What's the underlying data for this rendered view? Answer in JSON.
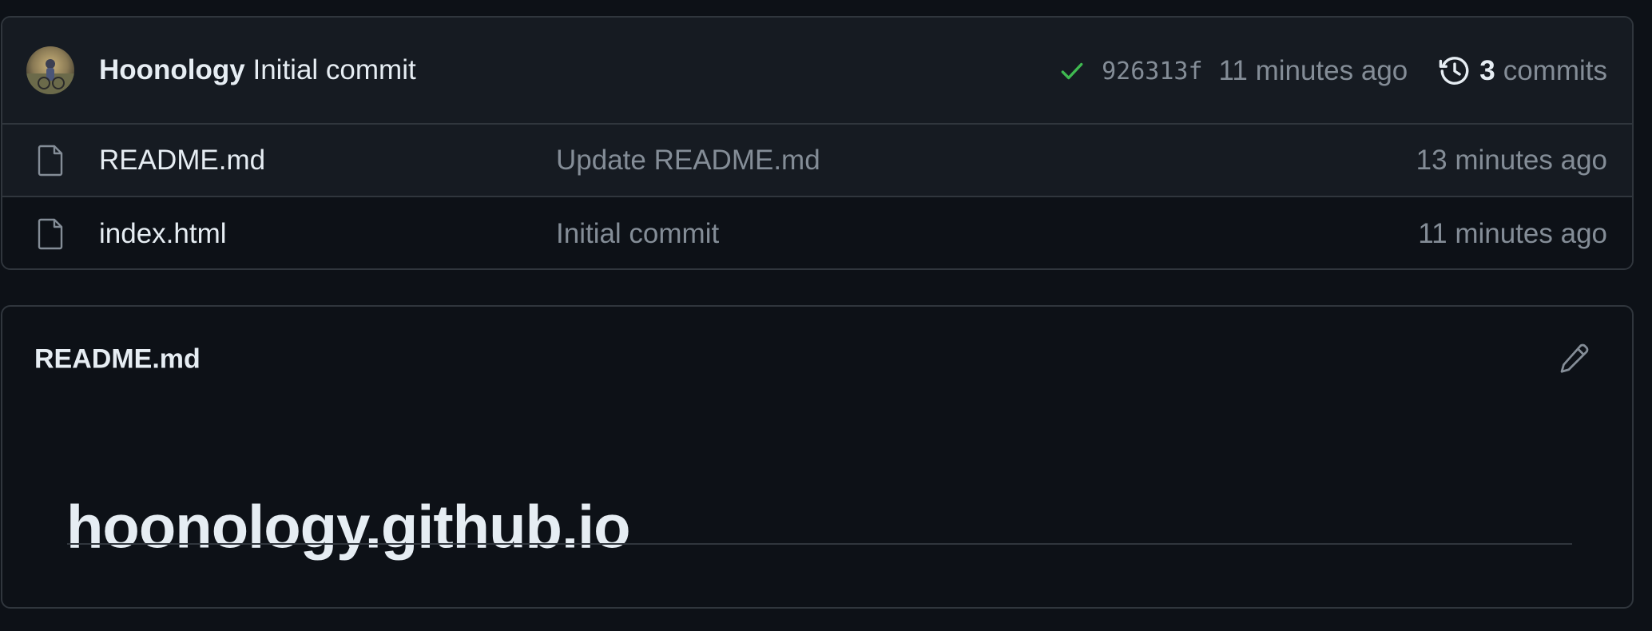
{
  "latest_commit": {
    "author": "Hoonology",
    "message": "Initial commit",
    "sha": "926313f",
    "time": "11 minutes ago",
    "commit_count": "3",
    "commits_label": "commits"
  },
  "files": [
    {
      "name": "README.md",
      "message": "Update README.md",
      "time": "13 minutes ago"
    },
    {
      "name": "index.html",
      "message": "Initial commit",
      "time": "11 minutes ago"
    }
  ],
  "readme": {
    "filename": "README.md",
    "heading": "hoonology.github.io"
  },
  "icons": {
    "check": "check-icon",
    "history": "history-icon",
    "file": "file-icon",
    "edit": "pencil-icon"
  },
  "colors": {
    "background": "#0d1117",
    "panel": "#161b22",
    "border": "#30363d",
    "text": "#e6edf3",
    "muted": "#848d97",
    "success": "#3fb950"
  }
}
